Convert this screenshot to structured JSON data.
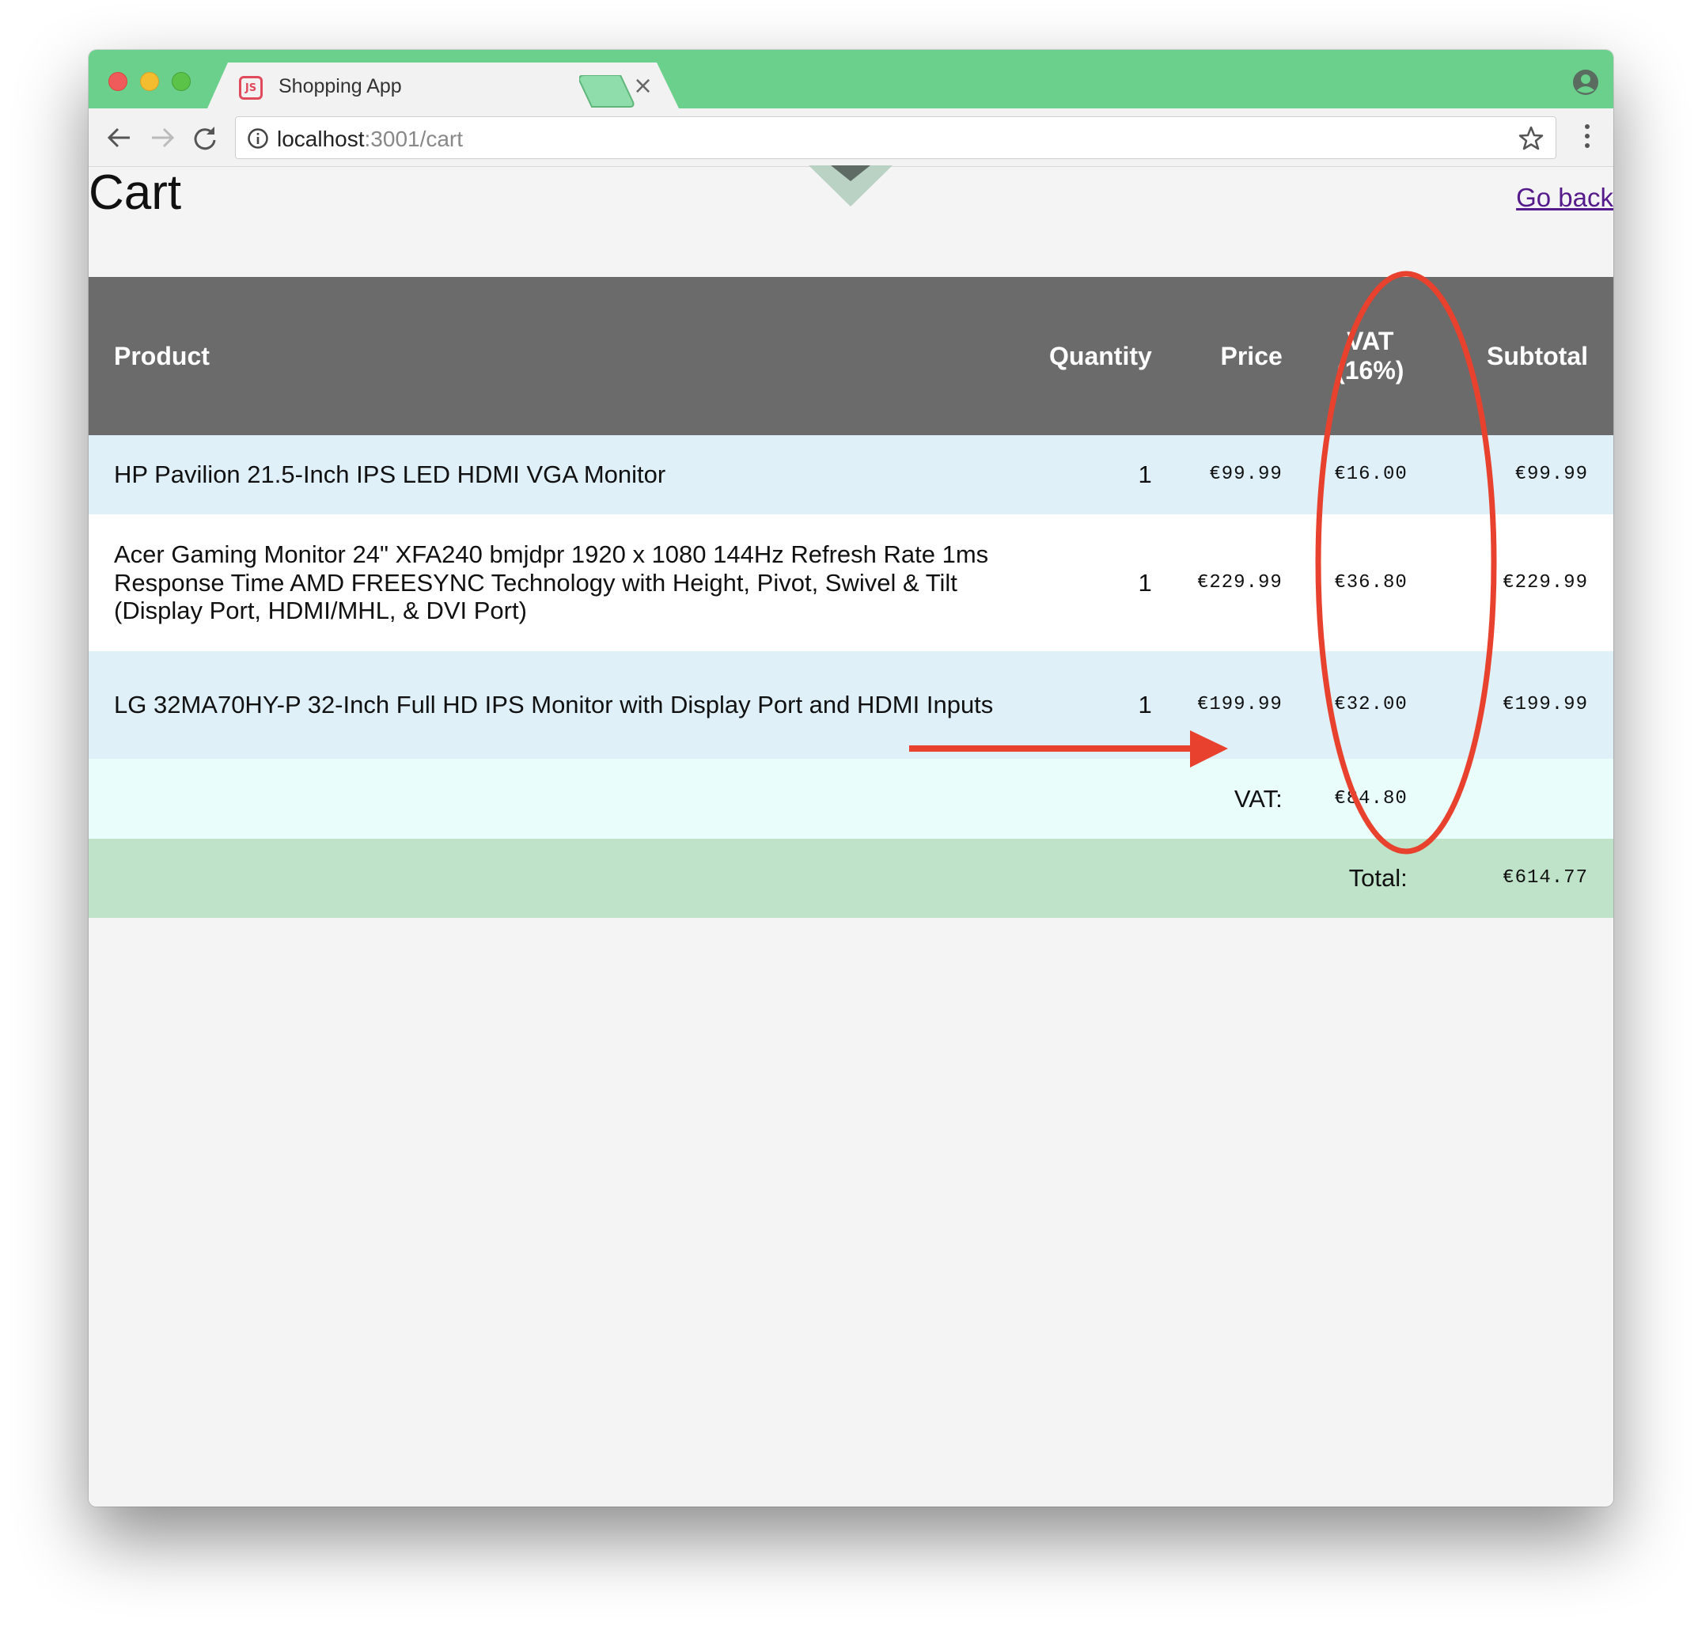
{
  "browser": {
    "tab_title": "Shopping App",
    "tab_favicon_text": "JS",
    "tab_close": "×",
    "url_host": "localhost",
    "url_path": ":3001/cart"
  },
  "page": {
    "title": "Cart",
    "go_back": "Go back"
  },
  "table": {
    "headers": {
      "product": "Product",
      "quantity": "Quantity",
      "price": "Price",
      "vat_line1": "VAT",
      "vat_line2": "(16%)",
      "subtotal": "Subtotal"
    },
    "rows": [
      {
        "product": "HP Pavilion 21.5-Inch IPS LED HDMI VGA Monitor",
        "quantity": "1",
        "price": "€99.99",
        "vat": "€16.00",
        "subtotal": "€99.99"
      },
      {
        "product": "Acer Gaming Monitor 24\" XFA240 bmjdpr 1920 x 1080 144Hz Refresh Rate 1ms Response Time AMD FREESYNC Technology with Height, Pivot, Swivel & Tilt (Display Port, HDMI/MHL, & DVI Port)",
        "quantity": "1",
        "price": "€229.99",
        "vat": "€36.80",
        "subtotal": "€229.99"
      },
      {
        "product": "LG 32MA70HY-P 32-Inch Full HD IPS Monitor with Display Port and HDMI Inputs",
        "quantity": "1",
        "price": "€199.99",
        "vat": "€32.00",
        "subtotal": "€199.99"
      }
    ],
    "vat_summary": {
      "label": "VAT:",
      "value": "€84.80"
    },
    "total_summary": {
      "label": "Total:",
      "value": "€614.77"
    }
  },
  "annotations": {
    "color": "#e8412d"
  },
  "colors": {
    "titlebar": "#6ad08b",
    "header_bg": "#6b6b6b",
    "row_alt": "#dff0f8",
    "vat_row": "#e9fdfb",
    "total_row": "#bfe3c9"
  }
}
